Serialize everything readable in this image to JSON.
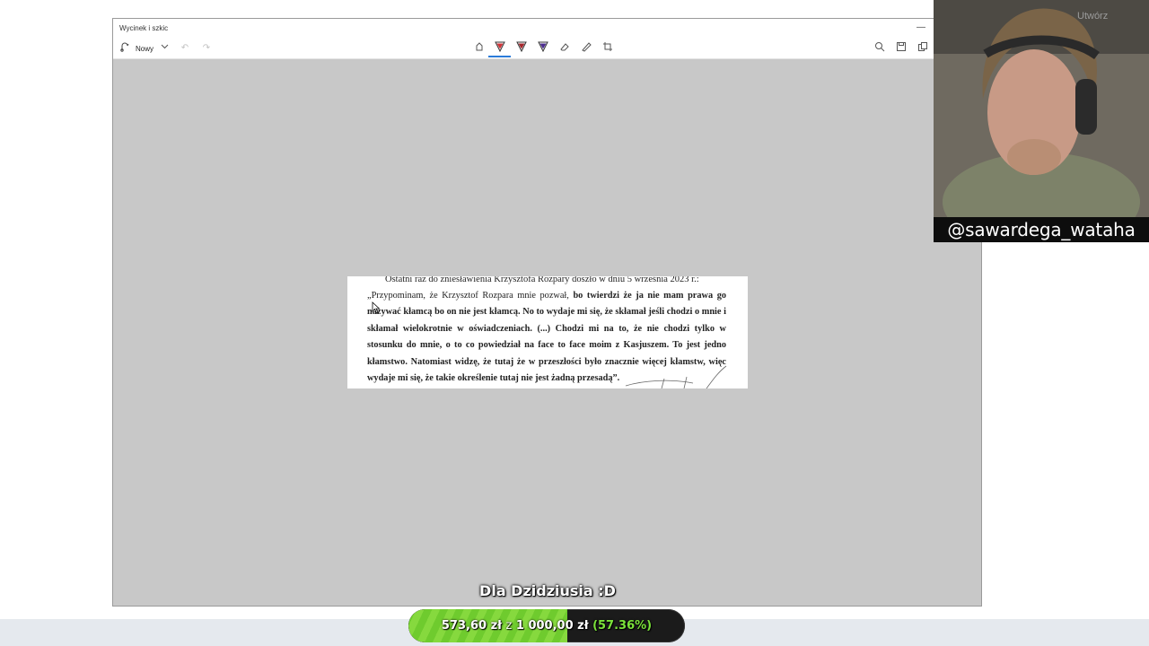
{
  "window": {
    "title": "Wycinek i szkic",
    "toolbar": {
      "new_label": "Nowy",
      "icons": [
        "new-snip-icon",
        "chevron-down-icon",
        "undo-icon",
        "redo-icon",
        "touch-writing-icon",
        "ballpoint-pen-icon",
        "pencil-icon",
        "highlighter-icon",
        "eraser-icon",
        "ruler-icon",
        "crop-icon",
        "zoom-icon",
        "save-icon",
        "copy-icon"
      ],
      "pen_colors": {
        "ballpoint": "#d13438",
        "pencil": "#a4262c",
        "highlighter": "#4b2c8f"
      },
      "accent": "#2b7bd9"
    },
    "canvas_background": "#c8c8c8"
  },
  "document": {
    "first_line": "Ostatni raz do zniesławienia Krzysztofa Rozpary doszło w dniu 5 września 2023 r.:",
    "quote_normal": "„Przypominam, że Krzysztof Rozpara mnie pozwał,",
    "quote_bold": " bo twierdzi że ja nie mam prawa go nazywać kłamcą bo on nie jest kłamcą. No to wydaje mi się, że skłamał jeśli chodzi o mnie i skłamał wielokrotnie w oświadczeniach. (...) Chodzi mi na to, że nie chodzi tylko w stosunku do mnie, o to co powiedział na face to face moim z Kasjuszem. To jest jedno kłamstwo. Natomiast widzę, że tutaj że w przeszłości było znacznie więcej kłamstw, więc wydaje mi się, że takie określenie tutaj nie jest żadną przesadą”."
  },
  "webcam": {
    "handle": "@sawardega_wataha",
    "overlay_text": "Utwórz"
  },
  "donation": {
    "caption": "Dla Dzidziusia :D",
    "raised": "573,60 zł",
    "separator": "z",
    "goal": "1 000,00 zł",
    "percent_label": "(57.36%)",
    "progress_fraction": 0.5736,
    "fill_color": "#76d033"
  }
}
